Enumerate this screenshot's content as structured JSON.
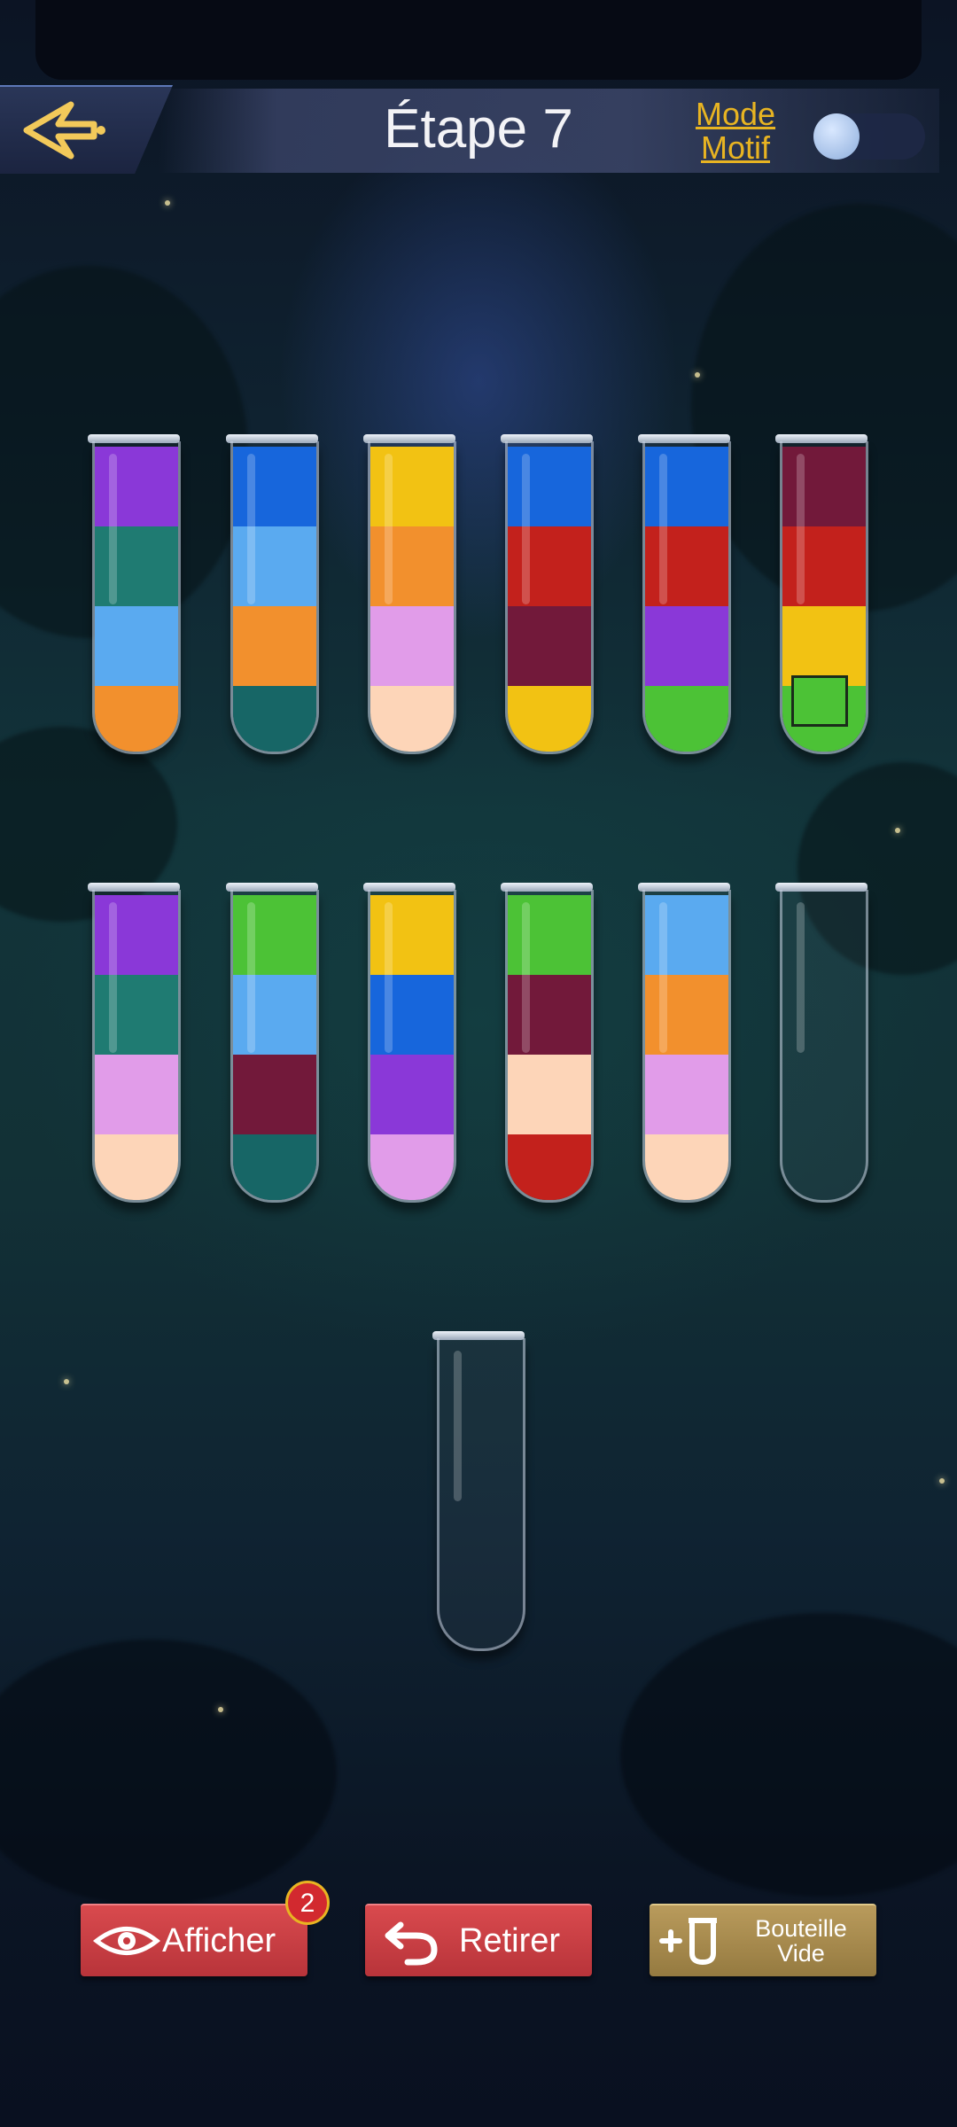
{
  "header": {
    "title": "Étape 7",
    "mode_label_line1": "Mode",
    "mode_label_line2": "Motif",
    "mode_toggle_on": false
  },
  "colors": {
    "purple": "#8a38d8",
    "teal": "#1f7b72",
    "light_blue": "#5aaaf0",
    "orange": "#f2902d",
    "blue": "#1766dc",
    "dark_teal": "#176666",
    "yellow": "#f2c213",
    "pink": "#e19ce9",
    "peach": "#fdd5b8",
    "red": "#c3211c",
    "maroon": "#72193a",
    "green": "#4cc236"
  },
  "tubes": [
    {
      "segments": [
        "purple",
        "teal",
        "light_blue",
        "orange"
      ]
    },
    {
      "segments": [
        "blue",
        "light_blue",
        "orange",
        "dark_teal"
      ]
    },
    {
      "segments": [
        "yellow",
        "orange",
        "pink",
        "peach"
      ]
    },
    {
      "segments": [
        "blue",
        "red",
        "maroon",
        "yellow"
      ]
    },
    {
      "segments": [
        "blue",
        "red",
        "purple",
        "green"
      ]
    },
    {
      "segments": [
        "maroon",
        "red",
        "yellow",
        "green"
      ]
    },
    {
      "segments": [
        "purple",
        "teal",
        "pink",
        "peach"
      ]
    },
    {
      "segments": [
        "green",
        "light_blue",
        "maroon",
        "dark_teal"
      ]
    },
    {
      "segments": [
        "yellow",
        "blue",
        "purple",
        "pink"
      ]
    },
    {
      "segments": [
        "green",
        "maroon",
        "peach",
        "red"
      ]
    },
    {
      "segments": [
        "light_blue",
        "orange",
        "pink",
        "peach"
      ]
    },
    {
      "segments": []
    },
    {
      "segments": []
    }
  ],
  "buttons": {
    "show_label": "Afficher",
    "show_badge": "2",
    "undo_label": "Retirer",
    "empty_bottle_line1": "Bouteille",
    "empty_bottle_line2": "Vide"
  }
}
